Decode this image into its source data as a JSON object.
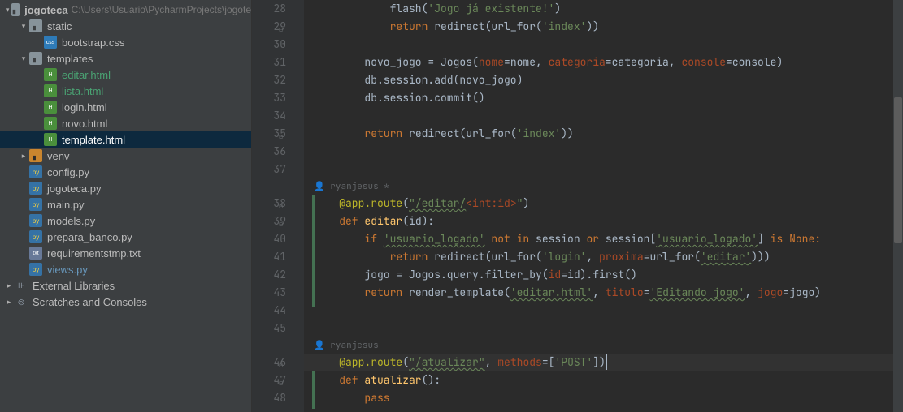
{
  "project": {
    "root_name": "jogoteca",
    "root_path": "C:\\Users\\Usuario\\PycharmProjects\\jogote",
    "tree": [
      {
        "indent": 0,
        "chev": "▾",
        "icon": "folder",
        "name": "jogoteca",
        "bold": true,
        "path": "C:\\Users\\Usuario\\PycharmProjects\\jogote"
      },
      {
        "indent": 1,
        "chev": "▾",
        "icon": "folder",
        "name": "static"
      },
      {
        "indent": 2,
        "chev": "",
        "icon": "css",
        "iconLabel": "css",
        "name": "bootstrap.css"
      },
      {
        "indent": 1,
        "chev": "▾",
        "icon": "folder",
        "name": "templates"
      },
      {
        "indent": 2,
        "chev": "",
        "icon": "html",
        "iconLabel": "H",
        "name": "editar.html",
        "hl": "teal"
      },
      {
        "indent": 2,
        "chev": "",
        "icon": "html",
        "iconLabel": "H",
        "name": "lista.html",
        "hl": "teal"
      },
      {
        "indent": 2,
        "chev": "",
        "icon": "html",
        "iconLabel": "H",
        "name": "login.html"
      },
      {
        "indent": 2,
        "chev": "",
        "icon": "html",
        "iconLabel": "H",
        "name": "novo.html"
      },
      {
        "indent": 2,
        "chev": "",
        "icon": "html",
        "iconLabel": "H",
        "name": "template.html",
        "selected": true
      },
      {
        "indent": 1,
        "chev": "▸",
        "icon": "folder-e",
        "name": "venv"
      },
      {
        "indent": 1,
        "chev": "",
        "icon": "py",
        "iconLabel": "py",
        "name": "config.py"
      },
      {
        "indent": 1,
        "chev": "",
        "icon": "py",
        "iconLabel": "py",
        "name": "jogoteca.py"
      },
      {
        "indent": 1,
        "chev": "",
        "icon": "py",
        "iconLabel": "py",
        "name": "main.py"
      },
      {
        "indent": 1,
        "chev": "",
        "icon": "py",
        "iconLabel": "py",
        "name": "models.py"
      },
      {
        "indent": 1,
        "chev": "",
        "icon": "py",
        "iconLabel": "py",
        "name": "prepara_banco.py"
      },
      {
        "indent": 1,
        "chev": "",
        "icon": "txt",
        "iconLabel": "txt",
        "name": "requirementstmp.txt"
      },
      {
        "indent": 1,
        "chev": "",
        "icon": "py",
        "iconLabel": "py",
        "name": "views.py",
        "hl": "blue"
      },
      {
        "indent": 0,
        "chev": "▸",
        "icon": "lib",
        "iconLabel": "⊪",
        "name": "External Libraries"
      },
      {
        "indent": 0,
        "chev": "▸",
        "icon": "lib",
        "iconLabel": "◎",
        "name": "Scratches and Consoles"
      }
    ]
  },
  "editor": {
    "annotation1": "ryanjesus *",
    "annotation2": "ryanjesus",
    "lines": {
      "l28_a": "            flash(",
      "l28_b": "'Jogo já existente!'",
      "l28_c": ")",
      "l29_a": "            ",
      "l29_b": "return ",
      "l29_c": "redirect(url_for(",
      "l29_d": "'index'",
      "l29_e": "))",
      "l31_a": "        novo_jogo = Jogos(",
      "l31_b": "nome",
      "l31_c": "=nome, ",
      "l31_d": "categoria",
      "l31_e": "=categoria, ",
      "l31_f": "console",
      "l31_g": "=console)",
      "l32": "        db.session.add(novo_jogo)",
      "l33": "        db.session.commit()",
      "l35_a": "        ",
      "l35_b": "return ",
      "l35_c": "redirect(url_for(",
      "l35_d": "'index'",
      "l35_e": "))",
      "l38_a": "    ",
      "l38_b": "@app.route",
      "l38_c": "(",
      "l38_d": "\"/editar/",
      "l38_e": "<int:id>",
      "l38_f": "\"",
      "l38_g": ")",
      "l39_a": "    ",
      "l39_b": "def ",
      "l39_c": "editar",
      "l39_d": "(id):",
      "l40_a": "        ",
      "l40_b": "if ",
      "l40_c": "'usuario_logado'",
      "l40_d": " not in ",
      "l40_e": "session ",
      "l40_f": "or ",
      "l40_g": "session[",
      "l40_h": "'usuario_logado'",
      "l40_i": "] ",
      "l40_j": "is ",
      "l40_k": "None:",
      "l41_a": "            ",
      "l41_b": "return ",
      "l41_c": "redirect(url_for(",
      "l41_d": "'login'",
      "l41_e": ", ",
      "l41_f": "proxima",
      "l41_g": "=url_for(",
      "l41_h": "'editar'",
      "l41_i": ")))",
      "l42_a": "        jogo = Jogos.query.filter_by(",
      "l42_b": "id",
      "l42_c": "=id).first()",
      "l43_a": "        ",
      "l43_b": "return ",
      "l43_c": "render_template(",
      "l43_d": "'editar.html'",
      "l43_e": ", ",
      "l43_f": "titulo",
      "l43_g": "=",
      "l43_h": "'Editando jogo'",
      "l43_i": ", ",
      "l43_j": "jogo",
      "l43_k": "=jogo)",
      "l46_a": "    ",
      "l46_b": "@app.route",
      "l46_c": "(",
      "l46_d": "\"/atualizar\"",
      "l46_e": ", ",
      "l46_f": "methods",
      "l46_g": "=[",
      "l46_h": "'POST'",
      "l46_i": "])",
      "l47_a": "    ",
      "l47_b": "def ",
      "l47_c": "atualizar",
      "l47_d": "():",
      "l48_a": "        ",
      "l48_b": "pass"
    },
    "line_numbers": [
      "28",
      "29",
      "30",
      "31",
      "32",
      "33",
      "34",
      "35",
      "36",
      "37",
      "",
      "38",
      "39",
      "40",
      "41",
      "42",
      "43",
      "44",
      "45",
      "",
      "46",
      "47",
      "48"
    ]
  }
}
